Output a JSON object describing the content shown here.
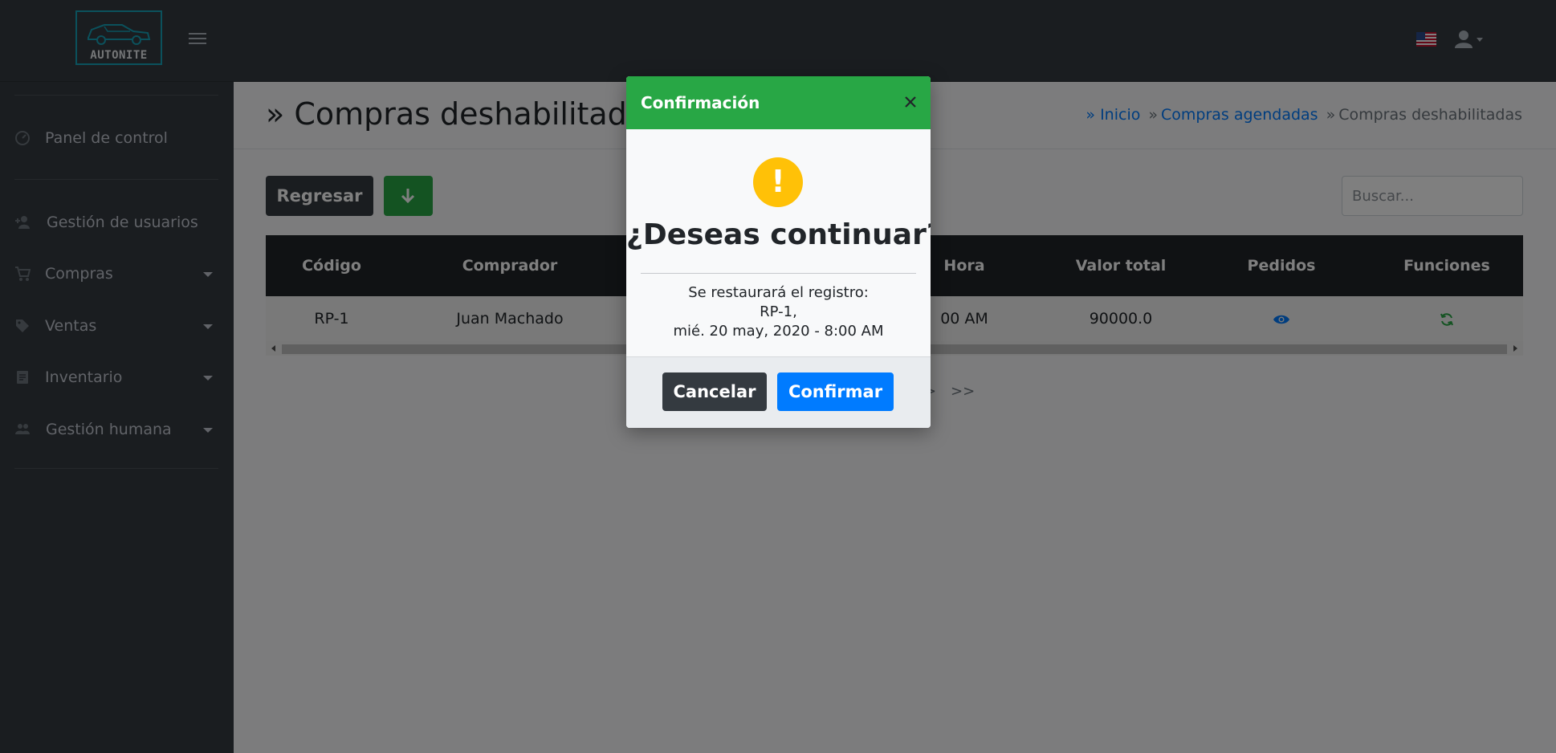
{
  "brand": {
    "logo_text": "AUTONITE"
  },
  "topbar": {
    "flag_icon": "us-flag-icon",
    "user_icon": "user-dropdown-icon"
  },
  "sidebar": {
    "items": [
      {
        "label": "Panel de control",
        "icon": "dashboard-icon"
      },
      {
        "label": "Gestión de usuarios",
        "icon": "add-user-icon"
      },
      {
        "label": "Compras",
        "icon": "cart-icon"
      },
      {
        "label": "Ventas",
        "icon": "tag-icon"
      },
      {
        "label": "Inventario",
        "icon": "clipboard-icon"
      },
      {
        "label": "Gestión humana",
        "icon": "people-icon"
      }
    ]
  },
  "header": {
    "title": "» Compras deshabilitadas",
    "breadcrumb": {
      "home": "» Inicio",
      "sep": "»",
      "parent": "Compras agendadas",
      "current": "Compras deshabilitadas"
    }
  },
  "toolbar": {
    "back_label": "Regresar",
    "download_icon": "arrow-down-icon",
    "search_placeholder": "Buscar..."
  },
  "table": {
    "columns": [
      "Código",
      "Comprador",
      "Hora",
      "Valor total",
      "Pedidos",
      "Funciones"
    ],
    "rows": [
      {
        "codigo": "RP-1",
        "comprador": "Juan Machado",
        "hora_visible": "00 AM",
        "valor": "90000.0",
        "pedidos_icon": "eye-icon",
        "funciones_icon": "restore-icon"
      }
    ]
  },
  "pagination": {
    "next": ">",
    "last": ">>"
  },
  "modal": {
    "title": "Confirmación",
    "icon_glyph": "!",
    "question": "¿Deseas continuar?",
    "message_lines": [
      "Se restaurará el registro:",
      "RP-1,",
      "mié. 20 may, 2020 - 8:00 AM"
    ],
    "cancel_label": "Cancelar",
    "confirm_label": "Confirmar"
  },
  "colors": {
    "success": "#28a745",
    "primary": "#007bff",
    "dark": "#343a40",
    "warning": "#ffc107"
  }
}
